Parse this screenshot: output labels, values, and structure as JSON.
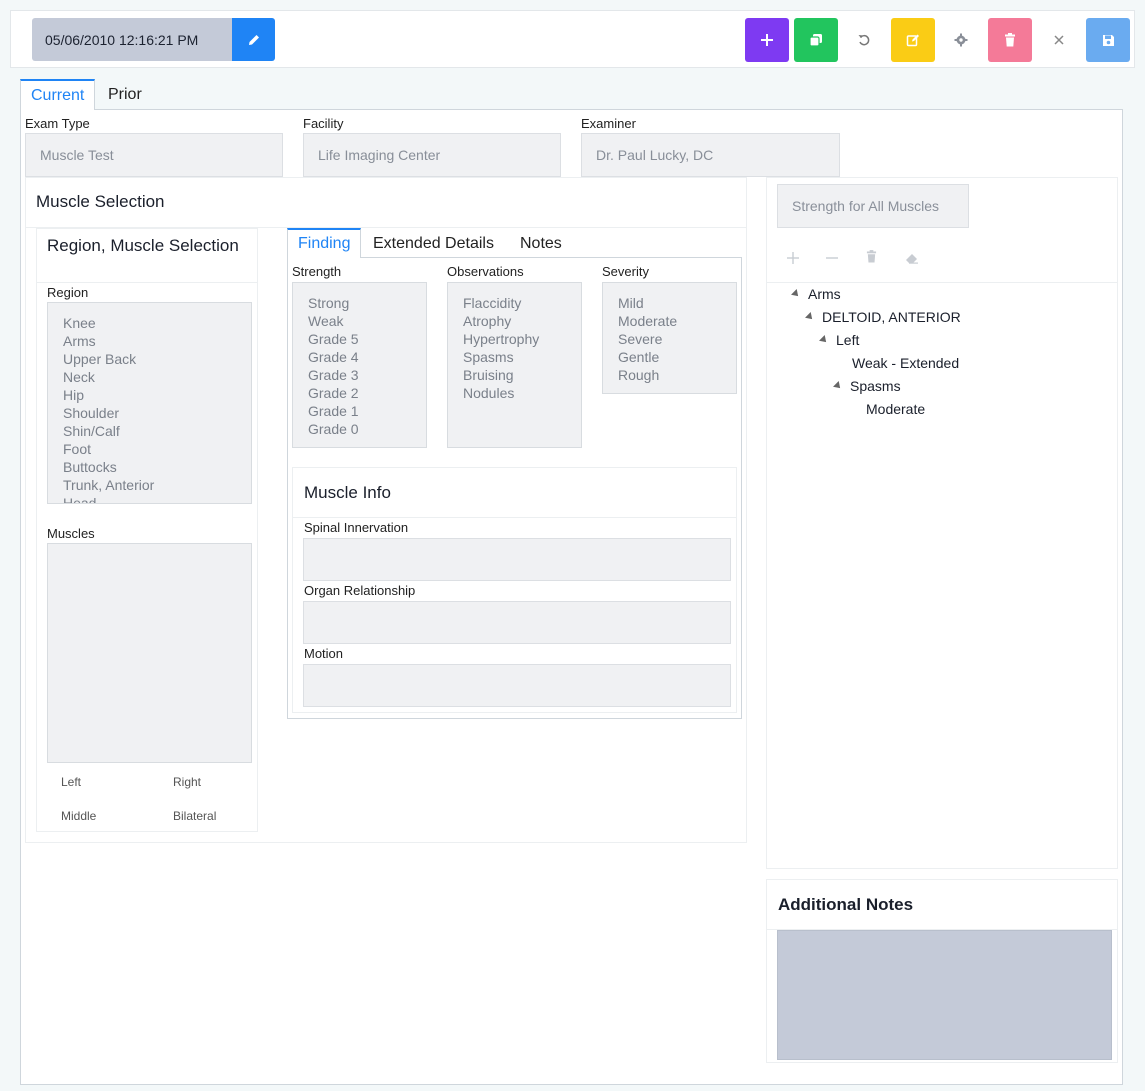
{
  "toolbar": {
    "datetime": "05/06/2010 12:16:21 PM",
    "colors": {
      "edit": "#1f84f5",
      "add": "#7e3af2",
      "copy": "#22c55e",
      "modify": "#facc15",
      "delete": "#f47a98",
      "save": "#6aabf0"
    }
  },
  "tabs": {
    "current": "Current",
    "prior": "Prior"
  },
  "exam": {
    "exam_type_label": "Exam Type",
    "exam_type_value": "Muscle Test",
    "facility_label": "Facility",
    "facility_value": "Life Imaging Center",
    "examiner_label": "Examiner",
    "examiner_value": "Dr. Paul Lucky, DC"
  },
  "muscle_selection": {
    "title": "Muscle Selection",
    "region_panel_title": "Region, Muscle Selection",
    "region_label": "Region",
    "regions": [
      "Knee",
      "Arms",
      "Upper Back",
      "Neck",
      "Hip",
      "Shoulder",
      "Shin/Calf",
      "Foot",
      "Buttocks",
      "Trunk, Anterior",
      "Head"
    ],
    "muscles_label": "Muscles",
    "side_options": [
      "Left",
      "Right",
      "Middle",
      "Bilateral"
    ]
  },
  "finding": {
    "tabs": [
      "Finding",
      "Extended Details",
      "Notes"
    ],
    "strength_label": "Strength",
    "strength": [
      "Strong",
      "Weak",
      "Grade 5",
      "Grade 4",
      "Grade 3",
      "Grade 2",
      "Grade 1",
      "Grade 0"
    ],
    "observations_label": "Observations",
    "observations": [
      "Flaccidity",
      "Atrophy",
      "Hypertrophy",
      "Spasms",
      "Bruising",
      "Nodules"
    ],
    "severity_label": "Severity",
    "severity": [
      "Mild",
      "Moderate",
      "Severe",
      "Gentle",
      "Rough"
    ],
    "muscle_info_title": "Muscle Info",
    "spinal_innervation_label": "Spinal Innervation",
    "organ_relationship_label": "Organ Relationship",
    "motion_label": "Motion"
  },
  "right_panel": {
    "strength_all_button": "Strength for All Muscles",
    "tree": {
      "arms": "Arms",
      "deltoid": "DELTOID, ANTERIOR",
      "left": "Left",
      "weak_extended": "Weak - Extended",
      "spasms": "Spasms",
      "moderate": "Moderate"
    },
    "additional_notes_title": "Additional Notes"
  }
}
